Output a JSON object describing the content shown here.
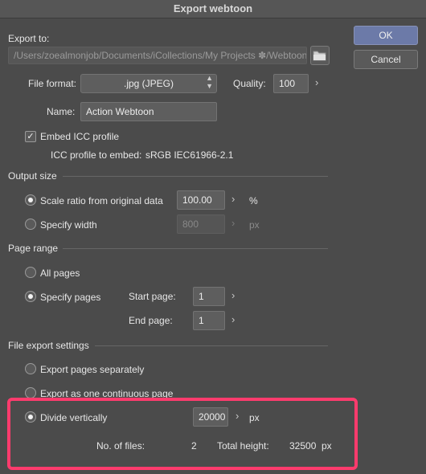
{
  "dialog": {
    "title": "Export webtoon",
    "ok_label": "OK",
    "cancel_label": "Cancel"
  },
  "export_to": {
    "label": "Export to:",
    "path": "/Users/zoealmonjob/Documents/iCollections/My Projects ✽/Webtoons"
  },
  "file_format": {
    "label": "File format:",
    "value": ".jpg (JPEG)",
    "quality_label": "Quality:",
    "quality_value": "100"
  },
  "name": {
    "label": "Name:",
    "value": "Action Webtoon"
  },
  "icc": {
    "embed_label": "Embed ICC profile",
    "embed_checked": true,
    "profile_label": "ICC profile to embed:",
    "profile_value": "sRGB IEC61966-2.1"
  },
  "output_size": {
    "section_label": "Output size",
    "scale_label": "Scale ratio from original data",
    "scale_value": "100.00",
    "scale_unit": "%",
    "width_label": "Specify width",
    "width_value": "800",
    "width_unit": "px",
    "selected": "scale"
  },
  "page_range": {
    "section_label": "Page range",
    "all_label": "All pages",
    "specify_label": "Specify pages",
    "start_label": "Start page:",
    "start_value": "1",
    "end_label": "End page:",
    "end_value": "1",
    "selected": "specify"
  },
  "file_export": {
    "section_label": "File export settings",
    "separate_label": "Export pages separately",
    "continuous_label": "Export as one continuous page",
    "divide_label": "Divide vertically",
    "divide_value": "20000",
    "divide_unit": "px",
    "files_label": "No. of files:",
    "files_value": "2",
    "total_label": "Total height:",
    "total_value": "32500",
    "total_unit": "px",
    "selected": "divide"
  },
  "colors": {
    "highlight": "#ff3b6d",
    "primary_button": "#6c7aa8"
  }
}
